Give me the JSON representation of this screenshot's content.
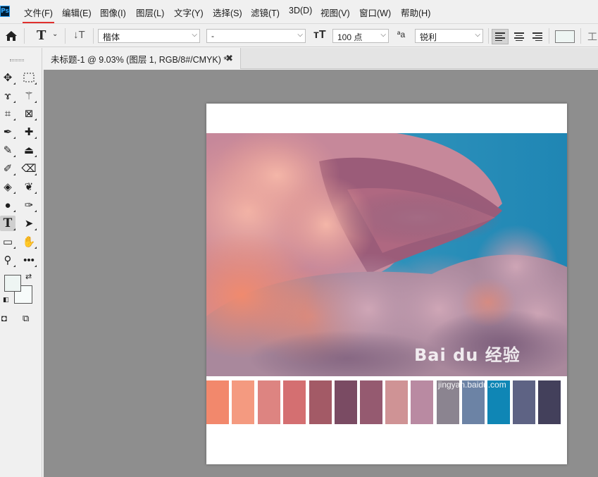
{
  "app": {
    "logo_text": "Ps"
  },
  "menu": [
    "文件(F)",
    "编辑(E)",
    "图像(I)",
    "图层(L)",
    "文字(Y)",
    "选择(S)",
    "滤镜(T)",
    "3D(D)",
    "视图(V)",
    "窗口(W)",
    "帮助(H)"
  ],
  "options": {
    "font_family": "楷体",
    "font_style": "-",
    "font_size": "100 点",
    "antialias_label": "ªa",
    "antialias": "锐利",
    "text_color": "#eef5f3"
  },
  "document": {
    "tab_title": "未标题-1 @ 9.03% (图层 1, RGB/8#/CMYK) *",
    "close_glyph": "✖"
  },
  "palette_colors": [
    "#f2886c",
    "#f49a80",
    "#dd8481",
    "#d46f71",
    "#a35a66",
    "#7a4b63",
    "#955a70",
    "#cf9395",
    "#b98aa2",
    "#8b8490",
    "#6c83a5",
    "#0f86b5",
    "#5e6384",
    "#43405b"
  ],
  "watermark": {
    "logo": "Bai du 经验",
    "url": "jingyan.baidu.com"
  }
}
